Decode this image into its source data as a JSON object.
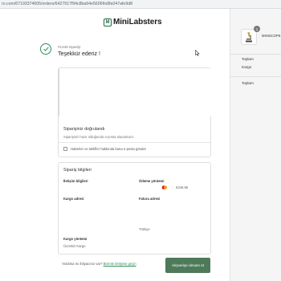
{
  "browser": {
    "url": "ro.com/67193374605/orders/6427917f94c8ba64e5606f/e8fa047afe9d8"
  },
  "logo": {
    "text": "MiniLabsters",
    "mark": "M"
  },
  "order": {
    "number": "#1248 siparişi",
    "thanks": "Teşekkür ederiz !"
  },
  "confirmation": {
    "title": "Siparişiniz doğrulandı",
    "subtitle": "Siparişiniz hazır olduğunda e-posta alacaksınız.",
    "newsletter_label": "Haberler ve teklifler hakkında bana e-posta gönder"
  },
  "order_info": {
    "title": "Sipariş bilgileri",
    "contact_label": "İletişim bilgileri",
    "payment_label": "Ödeme yöntemi",
    "payment_amount": "€349,95",
    "shipping_address_label": "Kargo adresi",
    "billing_address_label": "Fatura adresi",
    "country": "Türkiye",
    "shipping_method_label": "Kargo yöntemi",
    "shipping_method_value": "Ücretsiz Kargo"
  },
  "footer": {
    "help_text": "Yardıma mı ihtiyacınız var?",
    "contact_link": "Bizimle iletişime geçin",
    "continue_button": "Alışverişe devam et"
  },
  "summary": {
    "quantity": "1",
    "product_name": "MINISCOPE",
    "subtotal_label": "Toplam",
    "shipping_label": "Kargo",
    "total_label": "Toplam"
  },
  "colors": {
    "brand_green": "#1f6b43",
    "button": "#4e7a5a",
    "link": "#2f8f5a"
  }
}
